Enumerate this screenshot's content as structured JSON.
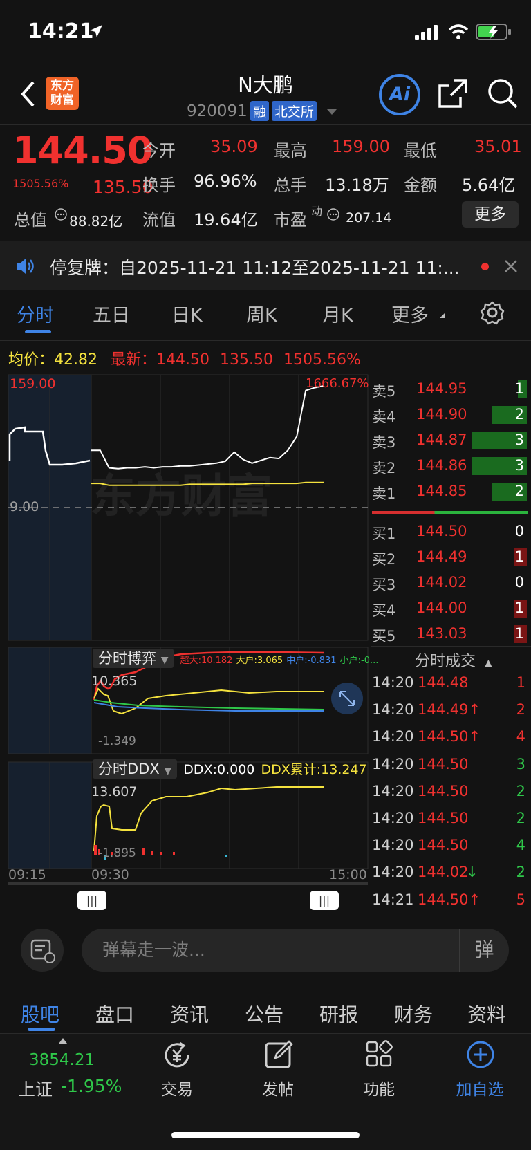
{
  "status_bar": {
    "time": "14:21"
  },
  "header": {
    "logo_text_1": "东方",
    "logo_text_2": "财富",
    "title": "N大鹏",
    "code": "920091",
    "tag_margin": "融",
    "tag_exchange": "北交所",
    "ai_label": "Ai"
  },
  "quote": {
    "price": "144.50",
    "change_pct": "1505.56%",
    "change_abs": "135.50",
    "open_label": "今开",
    "open": "35.09",
    "high_label": "最高",
    "high": "159.00",
    "low_label": "最低",
    "low": "35.01",
    "turnover_label": "换手",
    "turnover": "96.96%",
    "volume_label": "总手",
    "volume": "13.18万",
    "amount_label": "金额",
    "amount": "5.64亿",
    "mktcap_label": "总值",
    "mktcap": "88.82亿",
    "float_label": "流值",
    "float": "19.64亿",
    "pe_label": "市盈",
    "pe_sup": "动",
    "pe": "207.14",
    "more_label": "更多"
  },
  "notice": {
    "text": "停复牌：自2025-11-21 11:12至2025-11-21 11:..."
  },
  "tabs": [
    "分时",
    "五日",
    "日K",
    "周K",
    "月K",
    "更多"
  ],
  "chart_header": {
    "avg_label": "均价：",
    "avg": "42.82",
    "latest_label": "最新：",
    "latest": "144.50",
    "latest_chg": "135.50",
    "latest_pct": "1505.56%"
  },
  "chart_data": {
    "type": "line",
    "x_ticks": [
      "09:15",
      "09:30",
      "15:00"
    ],
    "price_axis": {
      "top": "159.00",
      "top_pct": "1666.67%",
      "base": "9.00"
    },
    "series": [
      {
        "name": "price",
        "color": "#ffffff",
        "values": [
          80,
          80,
          61,
          60,
          61,
          61,
          62,
          61,
          62,
          62,
          63,
          63,
          64,
          65,
          66,
          68,
          78,
          70,
          66,
          69,
          72,
          71,
          80,
          95,
          145,
          148,
          150
        ]
      },
      {
        "name": "avg",
        "color": "#f4e23e",
        "values": [
          44,
          44,
          42,
          42,
          42,
          42,
          42,
          42,
          42,
          42,
          42,
          43,
          43,
          43,
          43,
          43,
          43,
          43,
          44,
          44,
          44,
          44,
          44,
          44,
          45,
          45,
          45
        ]
      }
    ],
    "watermark": "东方财富"
  },
  "game_panel": {
    "label": "分时博弈",
    "super_label": "超大:10.182",
    "big_label": "大户:3.065",
    "mid_label": "中户:-0.831",
    "small_label": "小户:-0...",
    "top_val": "10.365",
    "bottom_val": "-1.349"
  },
  "ddx_panel": {
    "label": "分时DDX",
    "ddx_label": "DDX:0.000",
    "ddx_cum_label": "DDX累计:13.247",
    "top_val": "13.607",
    "bottom_val": "-1.895"
  },
  "order_book": {
    "asks": [
      {
        "label": "卖5",
        "price": "144.95",
        "vol": "1",
        "fill": 0.12
      },
      {
        "label": "卖4",
        "price": "144.90",
        "vol": "2",
        "fill": 0.46
      },
      {
        "label": "卖3",
        "price": "144.87",
        "vol": "3",
        "fill": 0.72
      },
      {
        "label": "卖2",
        "price": "144.86",
        "vol": "3",
        "fill": 0.72
      },
      {
        "label": "卖1",
        "price": "144.85",
        "vol": "2",
        "fill": 0.46
      }
    ],
    "bids": [
      {
        "label": "买1",
        "price": "144.50",
        "vol": "0",
        "fill": 0
      },
      {
        "label": "买2",
        "price": "144.49",
        "vol": "1",
        "fill": 0.16
      },
      {
        "label": "买3",
        "price": "144.02",
        "vol": "0",
        "fill": 0
      },
      {
        "label": "买4",
        "price": "144.00",
        "vol": "1",
        "fill": 0.16
      },
      {
        "label": "买5",
        "price": "143.03",
        "vol": "1",
        "fill": 0.16
      }
    ]
  },
  "trades": {
    "title": "分时成交",
    "rows": [
      {
        "time": "14:20",
        "price": "144.48",
        "arrow": "",
        "vol": "1",
        "dir": "red"
      },
      {
        "time": "14:20",
        "price": "144.49↑",
        "arrow": "",
        "vol": "2",
        "dir": "red"
      },
      {
        "time": "14:20",
        "price": "144.50↑",
        "arrow": "",
        "vol": "4",
        "dir": "red"
      },
      {
        "time": "14:20",
        "price": "144.50",
        "arrow": "",
        "vol": "3",
        "dir": "green"
      },
      {
        "time": "14:20",
        "price": "144.50",
        "arrow": "",
        "vol": "2",
        "dir": "green"
      },
      {
        "time": "14:20",
        "price": "144.50",
        "arrow": "",
        "vol": "2",
        "dir": "green"
      },
      {
        "time": "14:20",
        "price": "144.50",
        "arrow": "",
        "vol": "4",
        "dir": "green"
      },
      {
        "time": "14:20",
        "price": "144.02",
        "arrow": "↓",
        "vol": "2",
        "dir": "green"
      },
      {
        "time": "14:21",
        "price": "144.50↑",
        "arrow": "",
        "vol": "5",
        "dir": "red"
      }
    ]
  },
  "danmu": {
    "placeholder": "弹幕走一波...",
    "send_label": "弹"
  },
  "bottom_tabs": [
    "股吧",
    "盘口",
    "资讯",
    "公告",
    "研报",
    "财务",
    "资料"
  ],
  "toolbar": {
    "index_value": "3854.21",
    "index_name": "上证",
    "index_chg": "-1.95%",
    "trade": "交易",
    "post": "发帖",
    "func": "功能",
    "add": "加自选"
  }
}
